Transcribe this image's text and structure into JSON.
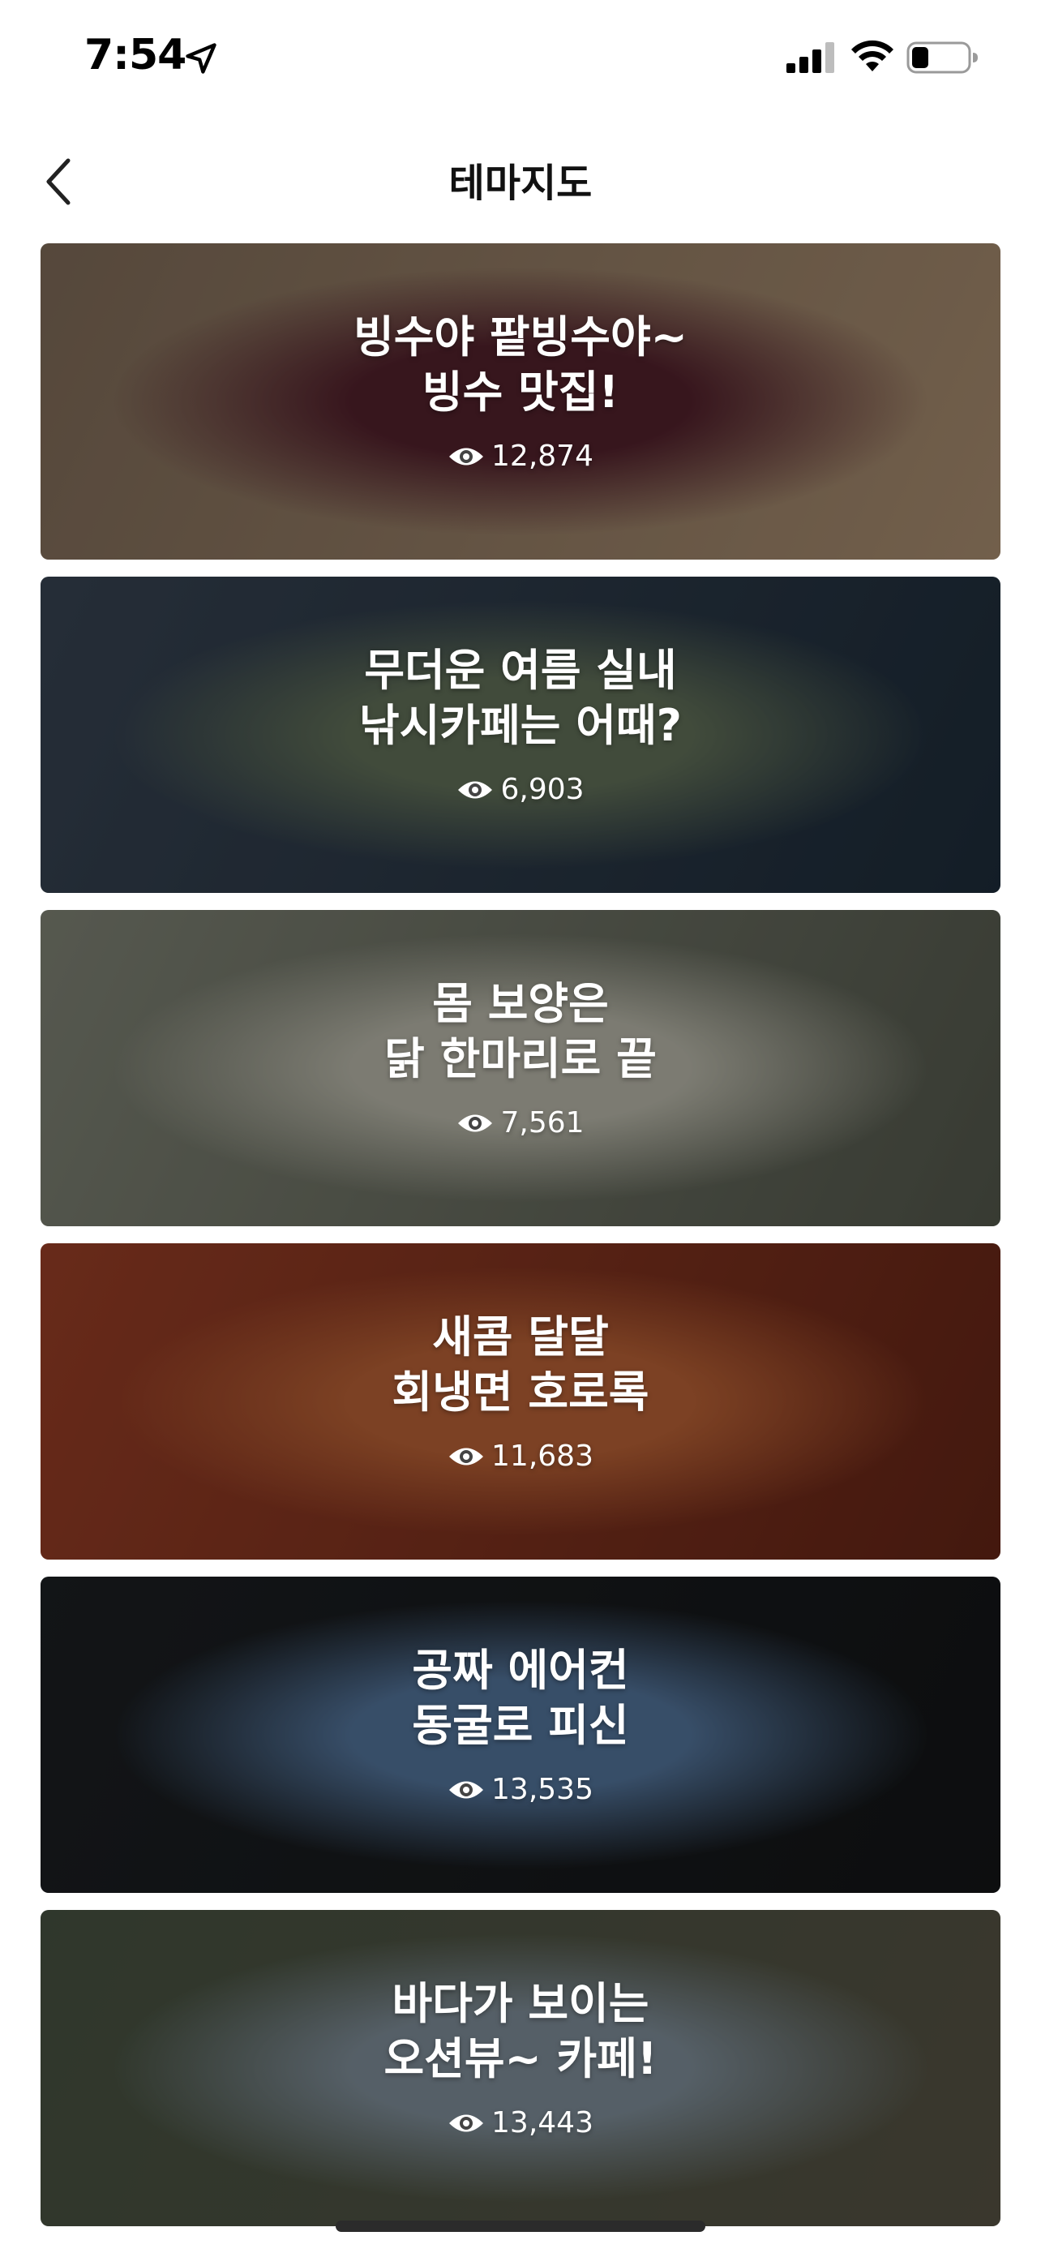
{
  "status_bar": {
    "time": "7:54",
    "icons": [
      "location-arrow-icon",
      "cellular-signal-icon",
      "wifi-icon",
      "battery-icon"
    ]
  },
  "header": {
    "back_icon": "chevron-left-icon",
    "title": "테마지도"
  },
  "cards": [
    {
      "line1": "빙수야 팥빙수야~",
      "line2": "빙수 맛집!",
      "views": "12,874",
      "bg_colors": [
        "#8a7460",
        "#5a2430",
        "#b89a7a"
      ]
    },
    {
      "line1": "무더운 여름 실내",
      "line2": "낚시카페는 어때?",
      "views": "6,903",
      "bg_colors": [
        "#3d4a5a",
        "#6a7a60",
        "#20303f"
      ]
    },
    {
      "line1": "몸 보양은",
      "line2": "닭 한마리로 끝",
      "views": "7,561",
      "bg_colors": [
        "#8b8f80",
        "#c8c7b8",
        "#5a5f52"
      ]
    },
    {
      "line1": "새콤 달달",
      "line2": "회냉면 호로록",
      "views": "11,683",
      "bg_colors": [
        "#a8452a",
        "#c96a3a",
        "#6d2818"
      ]
    },
    {
      "line1": "공짜 에어컨",
      "line2": "동굴로 피신",
      "views": "13,535",
      "bg_colors": [
        "#1e2226",
        "#5a7ea8",
        "#151719"
      ]
    },
    {
      "line1": "바다가 보이는",
      "line2": "오션뷰~ 카페!",
      "views": "13,443",
      "bg_colors": [
        "#4d5a48",
        "#8a9aa6",
        "#5e5a4a"
      ]
    }
  ]
}
